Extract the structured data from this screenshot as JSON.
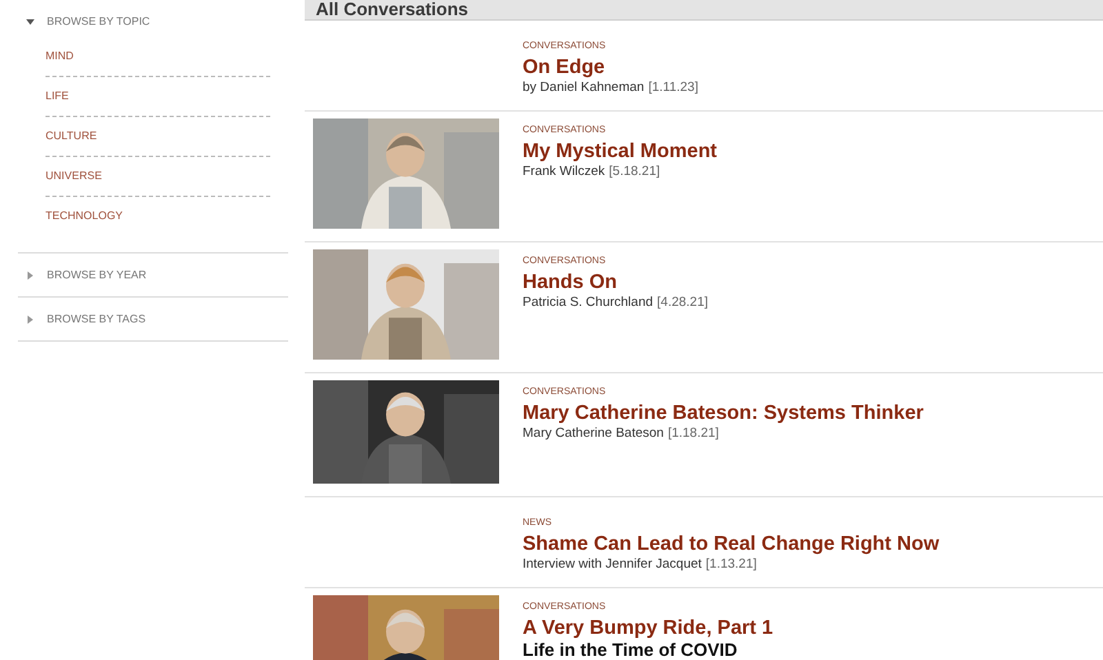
{
  "sidebar": {
    "sections": [
      {
        "label": "BROWSE BY TOPIC",
        "expanded": true,
        "items": [
          "MIND",
          "LIFE",
          "CULTURE",
          "UNIVERSE",
          "TECHNOLOGY"
        ]
      },
      {
        "label": "BROWSE BY YEAR",
        "expanded": false
      },
      {
        "label": "BROWSE BY TAGS",
        "expanded": false
      }
    ]
  },
  "main": {
    "heading": "All Conversations",
    "articles": [
      {
        "category": "CONVERSATIONS",
        "title": "On Edge",
        "byline": "by Daniel Kahneman",
        "date": "[1.11.23]",
        "picture": false
      },
      {
        "category": "CONVERSATIONS",
        "title": "My Mystical Moment",
        "byline": "Frank Wilczek",
        "date": "[5.18.21]",
        "picture": true
      },
      {
        "category": "CONVERSATIONS",
        "title": "Hands On",
        "byline": "Patricia S. Churchland",
        "date": "[4.28.21]",
        "picture": true
      },
      {
        "category": "CONVERSATIONS",
        "title": "Mary Catherine Bateson: Systems Thinker",
        "byline": "Mary Catherine Bateson",
        "date": "[1.18.21]",
        "picture": true
      },
      {
        "category": "NEWS",
        "title": "Shame Can Lead to Real Change Right Now",
        "byline": "Interview with Jennifer Jacquet",
        "date": "[1.13.21]",
        "picture": false
      },
      {
        "category": "CONVERSATIONS",
        "title": "A Very Bumpy Ride, Part 1",
        "subtitle": "Life in the Time of COVID",
        "picture": true
      }
    ]
  }
}
